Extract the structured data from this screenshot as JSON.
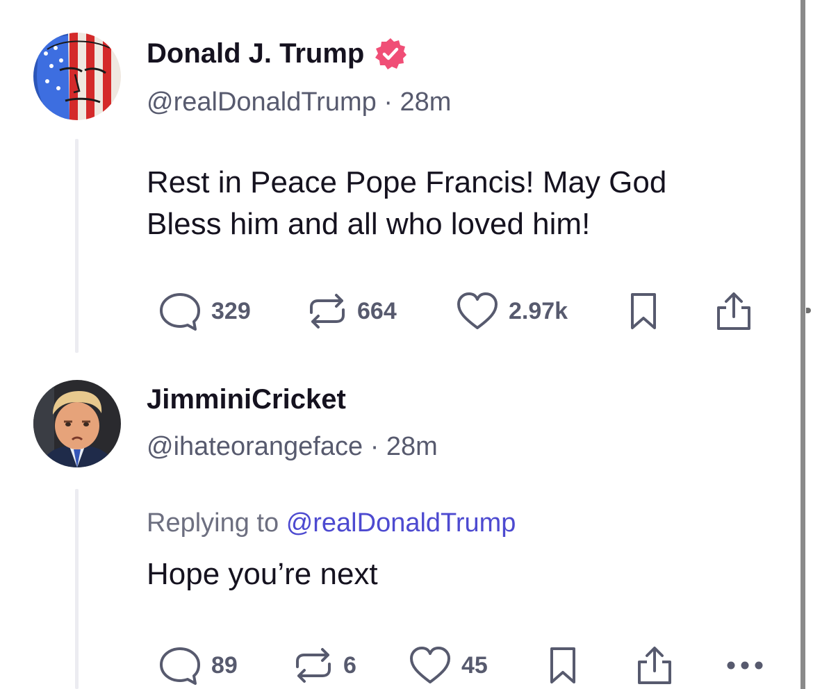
{
  "posts": [
    {
      "display_name": "Donald J. Trump",
      "verified": true,
      "handle": "@realDonaldTrump",
      "separator": "·",
      "time": "28m",
      "text_lines": [
        "Rest in Peace Pope Francis! May God",
        "Bless him and all who loved him!"
      ],
      "stats": {
        "replies": "329",
        "reposts": "664",
        "likes": "2.97k"
      },
      "avatar_icon": "avatar-flag-face",
      "colors": {
        "verified_badge": "#f04e76"
      }
    },
    {
      "display_name": "JimminiCricket",
      "verified": false,
      "handle": "@ihateorangeface",
      "separator": "·",
      "time": "28m",
      "replying_to_label": "Replying to",
      "replying_to_handle": "@realDonaldTrump",
      "text_lines": [
        "Hope you’re next"
      ],
      "stats": {
        "replies": "89",
        "reposts": "6",
        "likes": "45"
      },
      "avatar_icon": "avatar-photo",
      "more_icon": "ellipsis-icon",
      "colors": {
        "mention": "#4d4ad0"
      }
    }
  ],
  "colors": {
    "text": "#15121f",
    "muted": "#575a6e",
    "thread_line": "#ececf1"
  }
}
